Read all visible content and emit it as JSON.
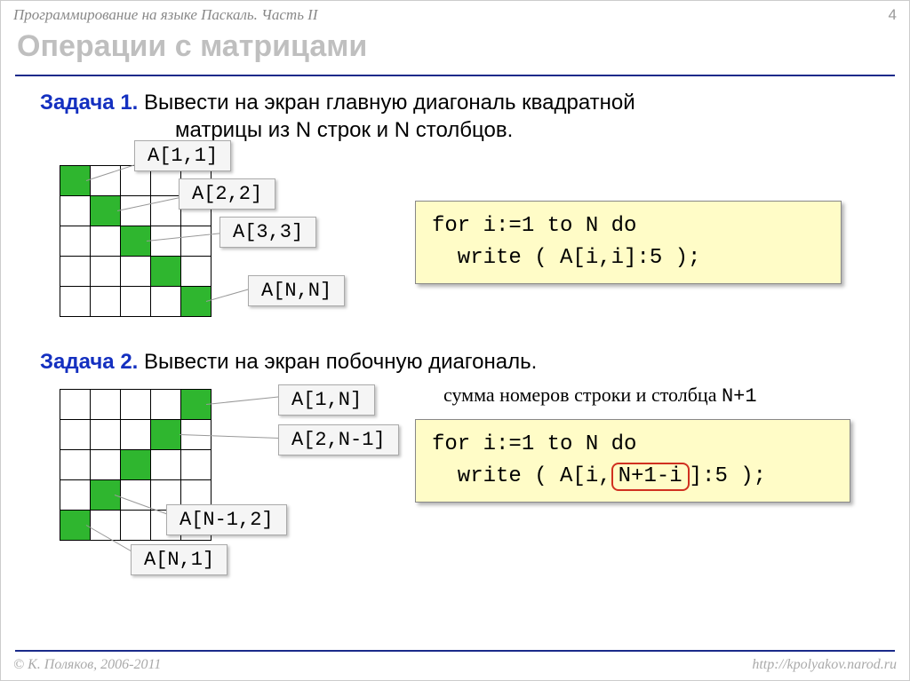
{
  "header": {
    "left": "Программирование на языке Паскаль. Часть II",
    "page": "4"
  },
  "title": "Операции с матрицами",
  "task1": {
    "label": "Задача 1.",
    "text": " Вывести на экран главную диагональ квадратной",
    "cont": "матрицы из N строк и N столбцов.",
    "labels": [
      "A[1,1]",
      "A[2,2]",
      "A[3,3]",
      "A[N,N]"
    ],
    "code": "for i:=1 to N do\n  write ( A[i,i]:5 );"
  },
  "task2": {
    "label": "Задача 2.",
    "text": " Вывести на экран побочную диагональ.",
    "note_pre": "сумма номеров строки и столбца ",
    "note_code": "N+1",
    "labels": [
      "A[1,N]",
      "A[2,N-1]",
      "A[N-1,2]",
      "A[N,1]"
    ],
    "code_pre": "for i:=1 to N do\n  write ( A[i,",
    "code_hl": "N+1-i",
    "code_post": "]:5 );"
  },
  "footer": {
    "left": "© К. Поляков, 2006-2011",
    "right": "http://kpolyakov.narod.ru"
  }
}
